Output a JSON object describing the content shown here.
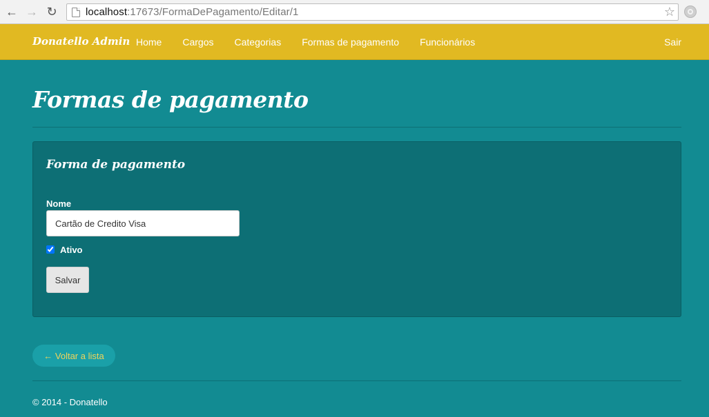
{
  "browser": {
    "url_host": "localhost",
    "url_rest": ":17673/FormaDePagamento/Editar/1",
    "back_glyph": "←",
    "forward_glyph": "→",
    "reload_glyph": "↻",
    "star_glyph": "☆"
  },
  "navbar": {
    "brand": "Donatello Admin",
    "links": [
      "Home",
      "Cargos",
      "Categorias",
      "Formas de pagamento",
      "Funcionários"
    ],
    "right_link": "Sair",
    "color": "#e1b922"
  },
  "page": {
    "title": "Formas de pagamento",
    "background": "#128b92"
  },
  "form": {
    "panel_title": "Forma de pagamento",
    "name_label": "Nome",
    "name_value": "Cartão de Credito Visa",
    "active_label": "Ativo",
    "active_checked": true,
    "save_label": "Salvar"
  },
  "back_link": "← Voltar a lista",
  "footer": "© 2014 - Donatello"
}
